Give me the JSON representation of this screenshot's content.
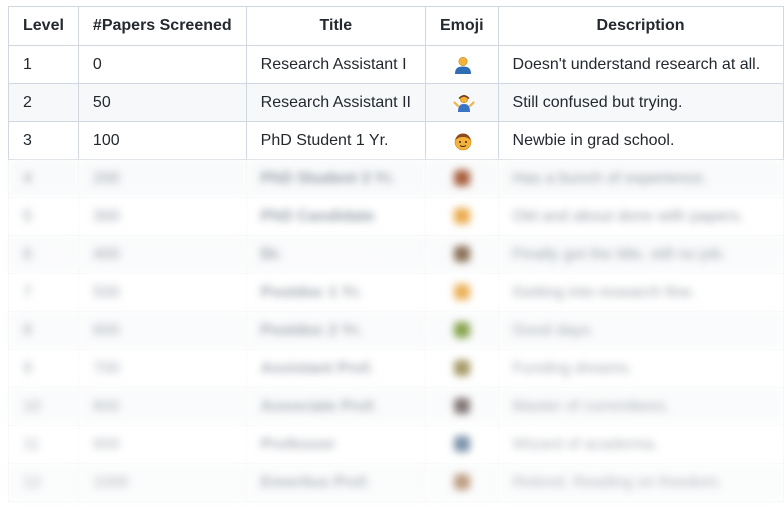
{
  "table": {
    "headers": {
      "level": "Level",
      "papers": "#Papers Screened",
      "title": "Title",
      "emoji": "Emoji",
      "description": "Description"
    },
    "rows": [
      {
        "level": "1",
        "papers": "0",
        "title": "Research Assistant I",
        "emoji": "person-icon",
        "description": "Doesn't understand research at all."
      },
      {
        "level": "2",
        "papers": "50",
        "title": "Research Assistant II",
        "emoji": "person-shrugging-icon",
        "description": "Still confused but trying."
      },
      {
        "level": "3",
        "papers": "100",
        "title": "PhD Student 1 Yr.",
        "emoji": "student-face-icon",
        "description": "Newbie in grad school."
      }
    ],
    "blurred_rows": [
      {
        "level": "4",
        "papers": "200",
        "title": "PhD Student 3 Yr.",
        "emoji_color": "#a0522d",
        "description": "Has a bunch of experience."
      },
      {
        "level": "5",
        "papers": "300",
        "title": "PhD Candidate",
        "emoji_color": "#e8a33a",
        "description": "Old and about done with papers."
      },
      {
        "level": "6",
        "papers": "400",
        "title": "Dr.",
        "emoji_color": "#7a5c3e",
        "description": "Finally got the title, still no job."
      },
      {
        "level": "7",
        "papers": "500",
        "title": "Postdoc 1 Yr.",
        "emoji_color": "#e8a33a",
        "description": "Getting into research fine."
      },
      {
        "level": "8",
        "papers": "600",
        "title": "Postdoc 2 Yr.",
        "emoji_color": "#6b8e23",
        "description": "Good days."
      },
      {
        "level": "9",
        "papers": "700",
        "title": "Assistant Prof.",
        "emoji_color": "#8b7d3a",
        "description": "Funding dreams."
      },
      {
        "level": "10",
        "papers": "800",
        "title": "Associate Prof.",
        "emoji_color": "#5a4a4a",
        "description": "Master of committees."
      },
      {
        "level": "11",
        "papers": "900",
        "title": "Professor",
        "emoji_color": "#4a6a8a",
        "description": "Wizard of academia."
      },
      {
        "level": "12",
        "papers": "1000",
        "title": "Emeritus Prof.",
        "emoji_color": "#a0724a",
        "description": "Retired. Reading on freedom."
      }
    ]
  }
}
